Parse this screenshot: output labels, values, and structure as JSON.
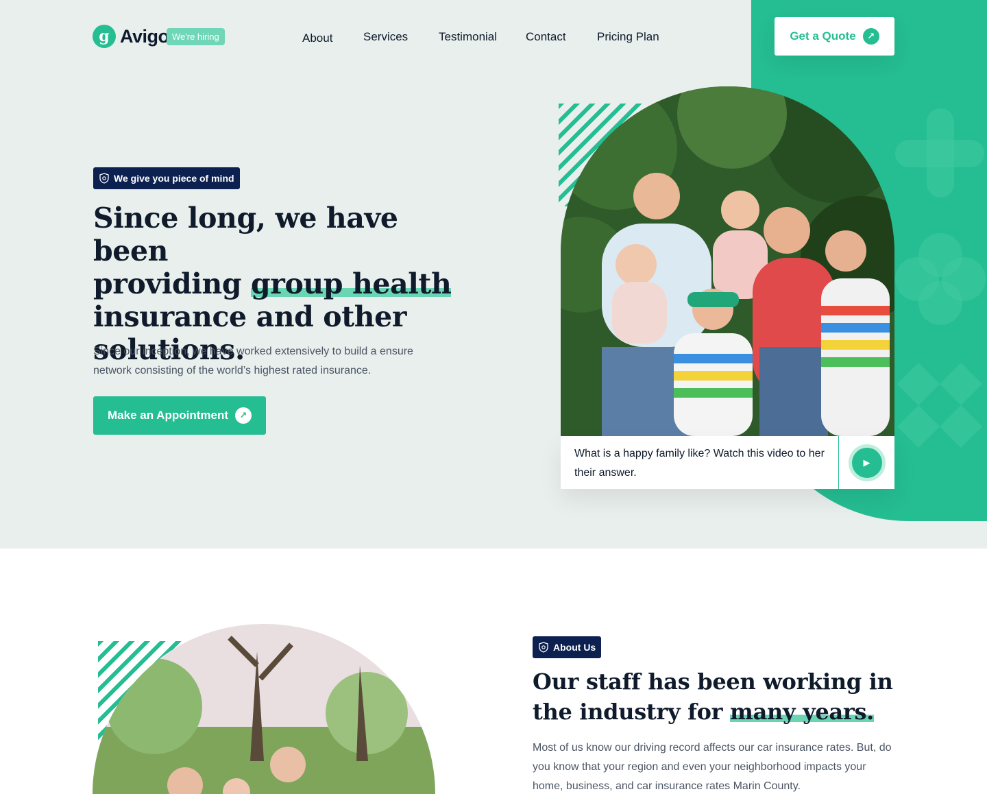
{
  "brand": {
    "name": "Avigo",
    "logo_letter": "g",
    "hiring_label": "We're hiring"
  },
  "nav": {
    "items": [
      {
        "label": "About"
      },
      {
        "label": "Services"
      },
      {
        "label": "Testimonial"
      },
      {
        "label": "Contact"
      },
      {
        "label": "Pricing Plan"
      }
    ],
    "cta_label": "Get a Quote",
    "cta_icon": "arrow-up-right-icon"
  },
  "hero": {
    "badge": "We give you piece of mind",
    "title_line1": "Since long, we have been",
    "title_line2_pre": "providing ",
    "title_line2_hl": "group health",
    "title_line3": "insurance and other",
    "title_line4": "solutions.",
    "description": "Since our inception, we have worked extensively to build a ensure network consisting of the world’s highest rated insurance.",
    "button_label": "Make an Appointment",
    "video_caption": "What is a happy family like? Watch this video to her their answer.",
    "play_icon": "play-icon"
  },
  "about": {
    "badge": "About Us",
    "title_pre": "Our staff has been working in the industry for ",
    "title_hl": "many years.",
    "description": "Most of us know our driving record affects our car insurance rates. But, do you know that your region and even your neighborhood impacts your home, business, and car insurance rates Marin County."
  },
  "colors": {
    "accent": "#25bd92",
    "navy": "#0d2150",
    "hero_bg": "#e9efed",
    "highlight": "#6ad5b3"
  }
}
